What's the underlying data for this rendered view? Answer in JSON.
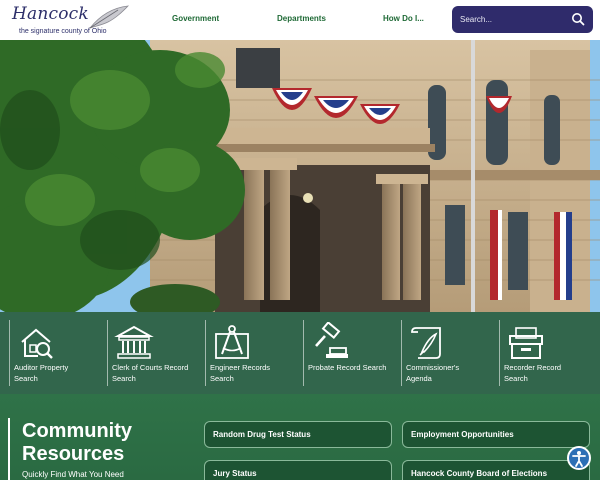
{
  "header": {
    "logo_title": "Hancock",
    "logo_subtitle": "the signature county of Ohio",
    "nav": [
      "Government",
      "Departments",
      "How Do I..."
    ],
    "search_placeholder": "Search..."
  },
  "quick_links": [
    {
      "label": "Auditor Property Search",
      "icon": "house-search-icon"
    },
    {
      "label": "Clerk of Courts Record Search",
      "icon": "courthouse-icon"
    },
    {
      "label": "Engineer Records Search",
      "icon": "compass-blueprint-icon"
    },
    {
      "label": "Probate Record Search",
      "icon": "gavel-icon"
    },
    {
      "label": "Commissioner's Agenda",
      "icon": "scroll-quill-icon"
    },
    {
      "label": "Recorder Record Search",
      "icon": "file-box-icon"
    }
  ],
  "community": {
    "title_line1": "Community",
    "title_line2": "Resources",
    "subtitle": "Quickly Find What You Need",
    "links": [
      "Random Drug Test Status",
      "Employment Opportunities",
      "Jury Status",
      "Hancock County Board of Elections"
    ]
  },
  "colors": {
    "brand_navy": "#2f2b6b",
    "brand_green": "#1f6a36",
    "band_green": "#225a3e"
  }
}
